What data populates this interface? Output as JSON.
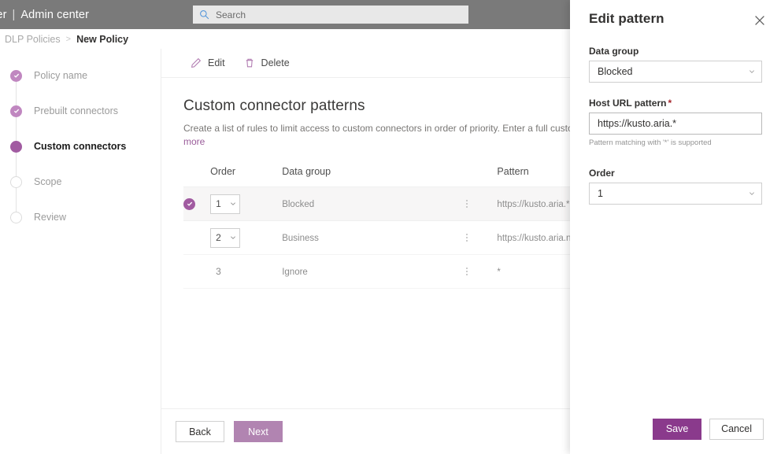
{
  "suite": {
    "title_clipped": "in center",
    "divider": "|",
    "app_name": "Admin center",
    "search_placeholder": "Search"
  },
  "breadcrumb": {
    "parent": "DLP Policies",
    "separator": ">",
    "current": "New Policy"
  },
  "wizard": {
    "steps": [
      {
        "label": "Policy name",
        "state": "done"
      },
      {
        "label": "Prebuilt connectors",
        "state": "done"
      },
      {
        "label": "Custom connectors",
        "state": "current"
      },
      {
        "label": "Scope",
        "state": "todo"
      },
      {
        "label": "Review",
        "state": "todo"
      }
    ]
  },
  "command_bar": {
    "edit_label": "Edit",
    "delete_label": "Delete"
  },
  "main": {
    "title": "Custom connector patterns",
    "description": "Create a list of rules to limit access to custom connectors in order of priority. Enter a full custom connector U",
    "more_link": "more",
    "table": {
      "columns": [
        "Order",
        "Data group",
        "Pattern"
      ],
      "rows": [
        {
          "order": "1",
          "order_type": "dropdown",
          "data_group": "Blocked",
          "pattern": "https://kusto.aria.*",
          "selected": true
        },
        {
          "order": "2",
          "order_type": "dropdown",
          "data_group": "Business",
          "pattern": "https://kusto.aria.net/",
          "selected": false
        },
        {
          "order": "3",
          "order_type": "static",
          "data_group": "Ignore",
          "pattern": "*",
          "selected": false
        }
      ]
    },
    "footer": {
      "back_label": "Back",
      "next_label": "Next"
    }
  },
  "panel": {
    "title": "Edit pattern",
    "data_group": {
      "label": "Data group",
      "value": "Blocked"
    },
    "host_url": {
      "label": "Host URL pattern",
      "required_marker": "*",
      "value": "https://kusto.aria.*",
      "hint": "Pattern matching with '*' is supported"
    },
    "order": {
      "label": "Order",
      "value": "1"
    },
    "save_label": "Save",
    "cancel_label": "Cancel"
  },
  "colors": {
    "accent_purple": "#8a3a8c",
    "accent_light": "#b184b1",
    "step_done": "#c087c0",
    "step_current": "#a15ba1",
    "suite_bar": "#7a7a7a"
  }
}
